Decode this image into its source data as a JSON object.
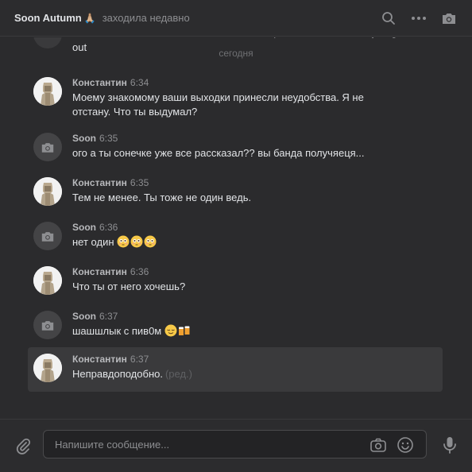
{
  "header": {
    "title": "Soon Autumn",
    "title_emoji": "🙏🏼",
    "status": "заходила недавно",
    "icons": [
      "search-icon",
      "more-icon",
      "camera-icon"
    ]
  },
  "feed": {
    "cut_text": "fuk if u wanna continue the thread i can't help u can u leave me... just get out",
    "date_separator": "сегодня",
    "messages": [
      {
        "sender": "Константин",
        "time": "6:34",
        "text": "Моему знакомому ваши выходки принесли неудобства. Я не отстану. Что ты выдумал?",
        "avatar": "photo"
      },
      {
        "sender": "Soon",
        "time": "6:35",
        "text": "ого а ты сонечке уже все рассказал?? вы банда получяеця...",
        "avatar": "camera"
      },
      {
        "sender": "Константин",
        "time": "6:35",
        "text": "Тем не менее. Ты тоже не один ведь.",
        "avatar": "photo"
      },
      {
        "sender": "Soon",
        "time": "6:36",
        "text": "нет один",
        "avatar": "camera",
        "emojis": [
          "flushed-emoji",
          "flushed-emoji",
          "flushed-emoji"
        ]
      },
      {
        "sender": "Константин",
        "time": "6:36",
        "text": "Что ты от него хочешь?",
        "avatar": "photo"
      },
      {
        "sender": "Soon",
        "time": "6:37",
        "text": "шашшлык с пив0м",
        "avatar": "camera",
        "emojis": [
          "relieved-emoji",
          "beer-mugs-emoji"
        ]
      },
      {
        "sender": "Константин",
        "time": "6:37",
        "text": "Неправдоподобно.",
        "avatar": "photo",
        "edited": "(ред.)",
        "highlighted": true
      }
    ]
  },
  "composer": {
    "placeholder": "Напишите сообщение...",
    "value": "",
    "icons": [
      "attach-icon",
      "camera-icon",
      "smile-icon",
      "microphone-icon"
    ]
  },
  "colors": {
    "background": "#2b2b2d",
    "header": "#2c2c2e",
    "text": "#e1e3e6",
    "muted": "#8d8e91",
    "highlight": "#3a3a3c"
  }
}
